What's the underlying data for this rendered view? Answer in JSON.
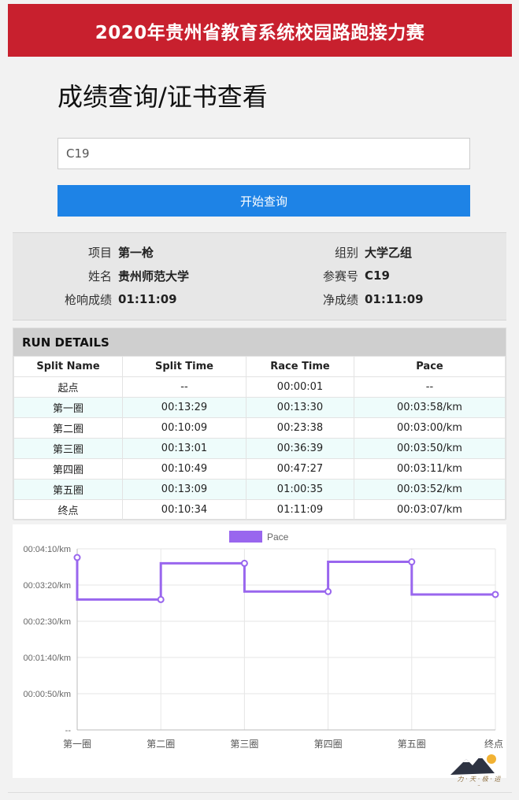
{
  "header": {
    "title": "2020年贵州省教育系统校园路跑接力赛"
  },
  "page": {
    "title": "成绩查询/证书查看"
  },
  "search": {
    "value": "C19",
    "button_label": "开始查询"
  },
  "summary": {
    "event_label": "项目",
    "event_value": "第一枪",
    "group_label": "组别",
    "group_value": "大学乙组",
    "name_label": "姓名",
    "name_value": "贵州师范大学",
    "bib_label": "参赛号",
    "bib_value": "C19",
    "gun_label": "枪响成绩",
    "gun_value": "01:11:09",
    "net_label": "净成绩",
    "net_value": "01:11:09"
  },
  "run_details": {
    "title": "RUN DETAILS",
    "columns": [
      "Split Name",
      "Split Time",
      "Race Time",
      "Pace"
    ],
    "rows": [
      [
        "起点",
        "--",
        "00:00:01",
        "--"
      ],
      [
        "第一圈",
        "00:13:29",
        "00:13:30",
        "00:03:58/km"
      ],
      [
        "第二圈",
        "00:10:09",
        "00:23:38",
        "00:03:00/km"
      ],
      [
        "第三圈",
        "00:13:01",
        "00:36:39",
        "00:03:50/km"
      ],
      [
        "第四圈",
        "00:10:49",
        "00:47:27",
        "00:03:11/km"
      ],
      [
        "第五圈",
        "00:13:09",
        "01:00:35",
        "00:03:52/km"
      ],
      [
        "终点",
        "00:10:34",
        "01:11:09",
        "00:03:07/km"
      ]
    ]
  },
  "chart_data": {
    "type": "line",
    "stepped": true,
    "series": [
      {
        "name": "Pace",
        "color": "#9966ee"
      }
    ],
    "categories": [
      "第一圈",
      "第二圈",
      "第三圈",
      "第四圈",
      "第五圈",
      "终点"
    ],
    "values_seconds": [
      238,
      180,
      230,
      191,
      232,
      187
    ],
    "y_ticks": [
      "--",
      "00:00:50/km",
      "00:01:40/km",
      "00:02:30/km",
      "00:03:20/km",
      "00:04:10/km"
    ],
    "y_tick_values": [
      0,
      50,
      100,
      150,
      200,
      250
    ],
    "ylim": [
      0,
      250
    ],
    "grid": true,
    "legend": "top-center"
  },
  "watermark": {
    "icon": "mountain-logo"
  }
}
